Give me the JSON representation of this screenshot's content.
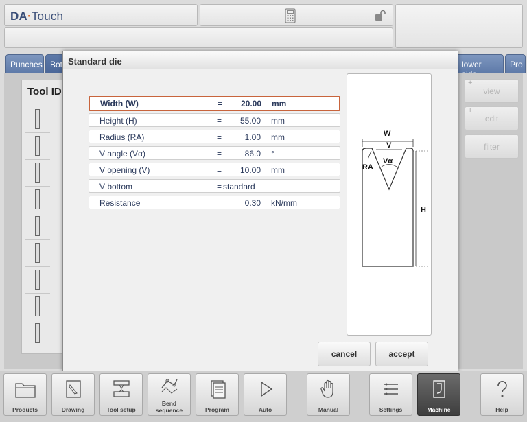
{
  "header": {
    "brand_prefix": "DA",
    "brand_suffix": "Touch",
    "center_icon": "calculator-icon",
    "lock_icon": "unlock-icon"
  },
  "tabs": [
    {
      "label": "Punches"
    },
    {
      "label": "Bot"
    },
    {
      "label": "lower side"
    },
    {
      "label": "Pro"
    }
  ],
  "background_table": {
    "column_header": "Tool ID"
  },
  "side_buttons": [
    {
      "label": "view"
    },
    {
      "label": "edit"
    },
    {
      "label": "filter"
    }
  ],
  "dialog": {
    "title": "Standard die",
    "params": [
      {
        "label": "Width (W)",
        "eq": "=",
        "value": "20.00",
        "unit": "mm"
      },
      {
        "label": "Height (H)",
        "eq": "=",
        "value": "55.00",
        "unit": "mm"
      },
      {
        "label": "Radius (RA)",
        "eq": "=",
        "value": "1.00",
        "unit": "mm"
      },
      {
        "label": "V angle (Vα)",
        "eq": "=",
        "value": "86.0",
        "unit": "°"
      },
      {
        "label": "V opening (V)",
        "eq": "=",
        "value": "10.00",
        "unit": "mm"
      },
      {
        "label": "V bottom",
        "eq": "=",
        "value": "standard",
        "unit": ""
      },
      {
        "label": "Resistance",
        "eq": "=",
        "value": "0.30",
        "unit": "kN/mm"
      }
    ],
    "diagram": {
      "label_w": "W",
      "label_v": "V",
      "label_ra": "RA",
      "label_va": "Vα",
      "label_h": "H"
    },
    "cancel_label": "cancel",
    "accept_label": "accept"
  },
  "bottom_nav": [
    {
      "label": "Products"
    },
    {
      "label": "Drawing"
    },
    {
      "label": "Tool setup"
    },
    {
      "label": "Bend sequence"
    },
    {
      "label": "Program"
    },
    {
      "label": "Auto"
    },
    {
      "label": "Manual"
    },
    {
      "label": "Settings"
    },
    {
      "label": "Machine"
    },
    {
      "label": "Help"
    }
  ]
}
